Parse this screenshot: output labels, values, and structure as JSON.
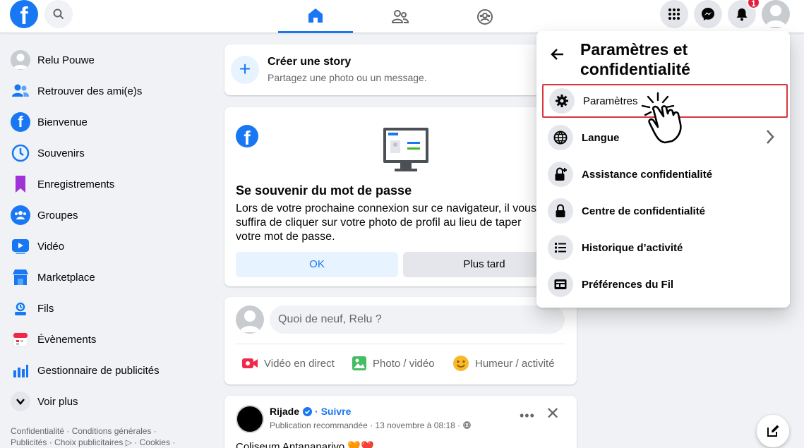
{
  "header": {
    "logo": "f",
    "tabs": [
      {
        "name": "home",
        "active": true
      },
      {
        "name": "friends",
        "active": false
      },
      {
        "name": "groups",
        "active": false
      }
    ],
    "notifications_count": "1"
  },
  "sidebar": {
    "items": [
      {
        "label": "Relu Pouwe",
        "icon": "avatar"
      },
      {
        "label": "Retrouver des ami(e)s",
        "icon": "friends-icon"
      },
      {
        "label": "Bienvenue",
        "icon": "facebook-icon"
      },
      {
        "label": "Souvenirs",
        "icon": "clock-icon"
      },
      {
        "label": "Enregistrements",
        "icon": "bookmark-icon"
      },
      {
        "label": "Groupes",
        "icon": "groups-icon"
      },
      {
        "label": "Vidéo",
        "icon": "video-icon"
      },
      {
        "label": "Marketplace",
        "icon": "shop-icon"
      },
      {
        "label": "Fils",
        "icon": "feeds-icon"
      },
      {
        "label": "Évènements",
        "icon": "calendar-icon"
      },
      {
        "label": "Gestionnaire de publicités",
        "icon": "chart-icon"
      },
      {
        "label": "Voir plus",
        "icon": "chevron-down-icon"
      }
    ],
    "footer_line1": "Confidentialité · Conditions générales ·",
    "footer_line2": "Publicités · Choix publicitaires ▷ · Cookies ·"
  },
  "story": {
    "title": "Créer une story",
    "subtitle": "Partagez une photo ou un message."
  },
  "password_card": {
    "title": "Se souvenir du mot de passe",
    "body": "Lors de votre prochaine connexion sur ce navigateur, il vous suffira de cliquer sur votre photo de profil au lieu de taper votre mot de passe.",
    "ok_label": "OK",
    "later_label": "Plus tard"
  },
  "composer": {
    "placeholder": "Quoi de neuf, Relu ?",
    "live_label": "Vidéo en direct",
    "photo_label": "Photo / vidéo",
    "mood_label": "Humeur / activité"
  },
  "post": {
    "author": "Rijade",
    "follow_label": "· Suivre",
    "meta": "Publication recommandée · 13 novembre à 08:18 ·",
    "text": "Coliseum Antananarivo 🧡❤️"
  },
  "settings_menu": {
    "title": "Paramètres et confidentialité",
    "items": [
      {
        "label": "Paramètres",
        "icon": "gear-icon"
      },
      {
        "label": "Langue",
        "icon": "globe-icon"
      },
      {
        "label": "Assistance confidentialité",
        "icon": "lock-plus-icon"
      },
      {
        "label": "Centre de confidentialité",
        "icon": "lock-icon"
      },
      {
        "label": "Historique d’activité",
        "icon": "list-icon"
      },
      {
        "label": "Préférences du Fil",
        "icon": "feed-pref-icon"
      }
    ]
  },
  "colors": {
    "brand": "#1877f2",
    "highlight": "#d9363e",
    "notification": "#e41e3f"
  }
}
